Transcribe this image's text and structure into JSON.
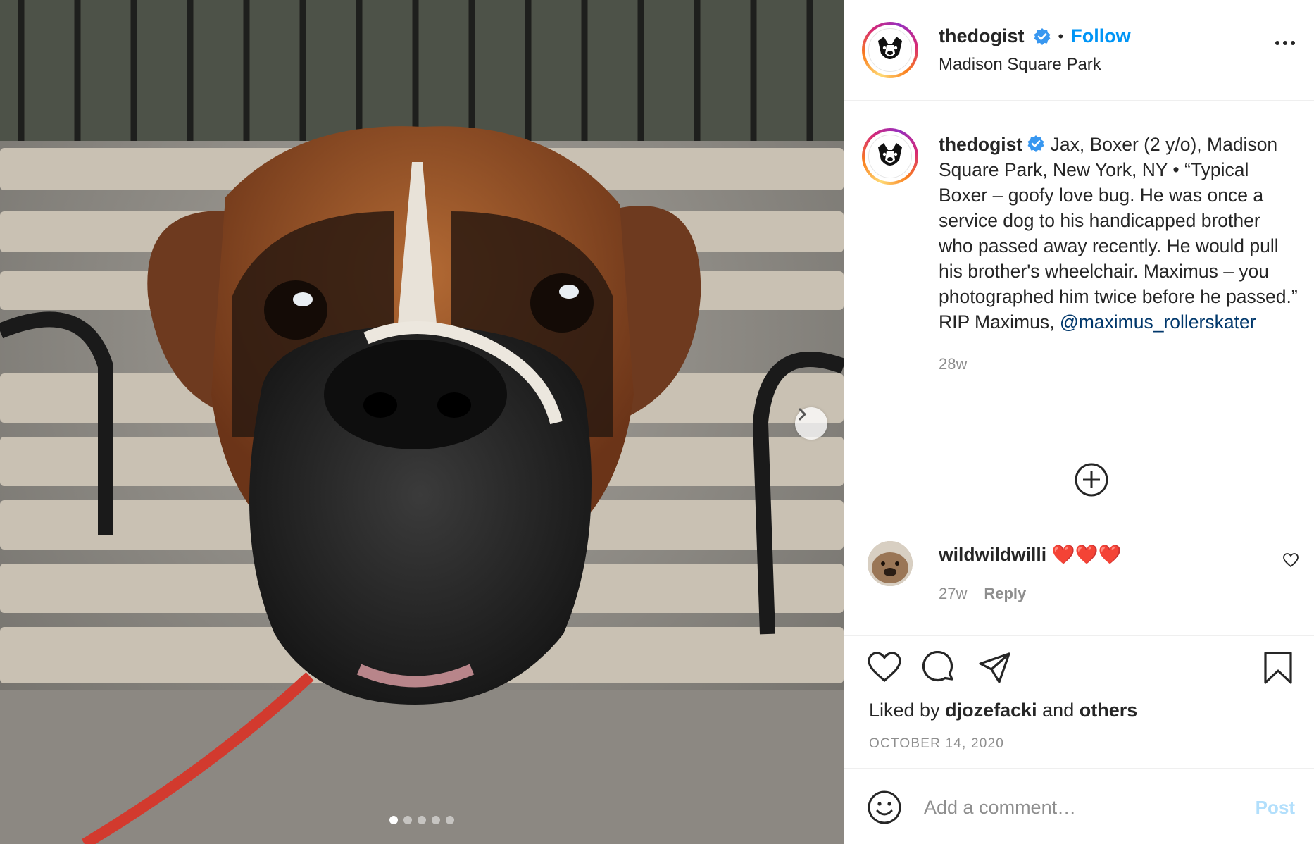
{
  "post": {
    "username": "thedogist",
    "follow_label": "Follow",
    "location": "Madison Square Park",
    "caption_user": "thedogist",
    "caption": "Jax, Boxer (2 y/o), Madison Square Park, New York, NY • “Typical Boxer – goofy love bug. He was once a service dog to his handicapped brother who passed away recently. He would pull his brother's wheelchair. Maximus – you photographed him twice before he passed.” RIP Maximus,",
    "mention": "@maximus_rollerskater",
    "caption_time": "28w",
    "separator": "•"
  },
  "comment": {
    "username": "wildwildwilli",
    "text": "❤️❤️❤️",
    "time": "27w",
    "reply_label": "Reply"
  },
  "likes": {
    "prefix": "Liked by",
    "user": "djozefacki",
    "and": "and",
    "others": "others"
  },
  "date": "OCTOBER 14, 2020",
  "comment_box": {
    "placeholder": "Add a comment…",
    "post_label": "Post"
  },
  "carousel": {
    "total": 5,
    "active": 1
  },
  "colors": {
    "accent": "#0095f6",
    "link": "#00376b",
    "muted": "#8e8e8e",
    "heart": "#ed4956"
  },
  "icons": [
    "verified-icon",
    "more-icon",
    "chevron-right-icon",
    "add-icon",
    "heart-icon",
    "comment-icon",
    "share-icon",
    "bookmark-icon",
    "emoji-icon"
  ]
}
